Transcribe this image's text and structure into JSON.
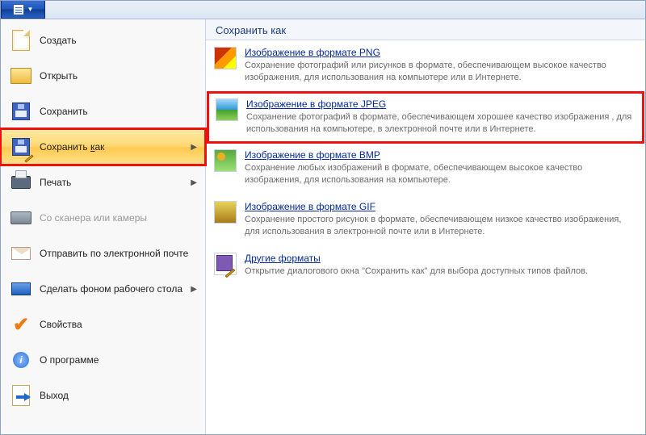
{
  "menu": {
    "create": "Создать",
    "open": "Открыть",
    "save": "Сохранить",
    "save_as_prefix": "Сохранить ",
    "save_as_key": "к",
    "save_as_suffix": "ак",
    "print": "Печать",
    "scanner": "Со сканера или камеры",
    "email": "Отправить по электронной почте",
    "desktop_bg": "Сделать фоном рабочего стола",
    "properties": "Свойства",
    "about": "О программе",
    "exit": "Выход"
  },
  "submenu": {
    "header": "Сохранить как",
    "png": {
      "title_prefix": "Изображение в формате ",
      "title_key": "P",
      "title_suffix": "NG",
      "desc": "Сохранение фотографий или рисунков в формате, обеспечивающем высокое качество изображения, для использования на компьютере или в Интернете."
    },
    "jpeg": {
      "title_prefix": "Изобра",
      "title_key": "ж",
      "title_suffix": "ение в формате JPEG",
      "desc": "Сохранение фотографий в формате, обеспечивающем хорошее качество изображения , для использования на компьютере, в электронной почте или в Интернете."
    },
    "bmp": {
      "title_prefix": "Изображение в формате ",
      "title_key": "B",
      "title_suffix": "MP",
      "desc": "Сохранение любых изображений в формате, обеспечивающем высокое качество изображения, для использования на компьютере."
    },
    "gif": {
      "title_prefix": "Изображение в формате ",
      "title_key": "G",
      "title_suffix": "IF",
      "desc": "Сохранение простого рисунок в формате, обеспечивающем низкое качество изображения, для использования в электронной почте или в Интернете."
    },
    "other": {
      "title_prefix": "",
      "title_key": "Д",
      "title_suffix": "ругие форматы",
      "desc": "Открытие диалогового окна \"Сохранить как\" для выбора доступных типов файлов."
    }
  }
}
